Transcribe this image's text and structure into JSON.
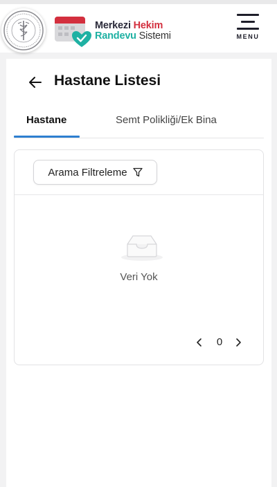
{
  "header": {
    "brand_line1_part1": "Merkezi ",
    "brand_line1_part2": "Hekim",
    "brand_line2_part1": "Randevu",
    "brand_line2_part2": " Sistemi",
    "menu_label": "MENU"
  },
  "page": {
    "title": "Hastane Listesi"
  },
  "tabs": [
    {
      "label": "Hastane",
      "active": true
    },
    {
      "label": "Semt Polikliği/Ek Bina",
      "active": false
    }
  ],
  "filter": {
    "label": "Arama Filtreleme"
  },
  "empty_state": {
    "text": "Veri Yok"
  },
  "pagination": {
    "current": "0"
  },
  "colors": {
    "accent_blue": "#2d7fd0",
    "brand_red": "#d32f3e",
    "brand_teal": "#1fb1a3"
  },
  "icons": [
    "ministry-seal-icon",
    "mhrs-logo-icon",
    "hamburger-menu-icon",
    "arrow-left-icon",
    "filter-icon",
    "empty-inbox-icon",
    "chevron-left-icon",
    "chevron-right-icon"
  ]
}
